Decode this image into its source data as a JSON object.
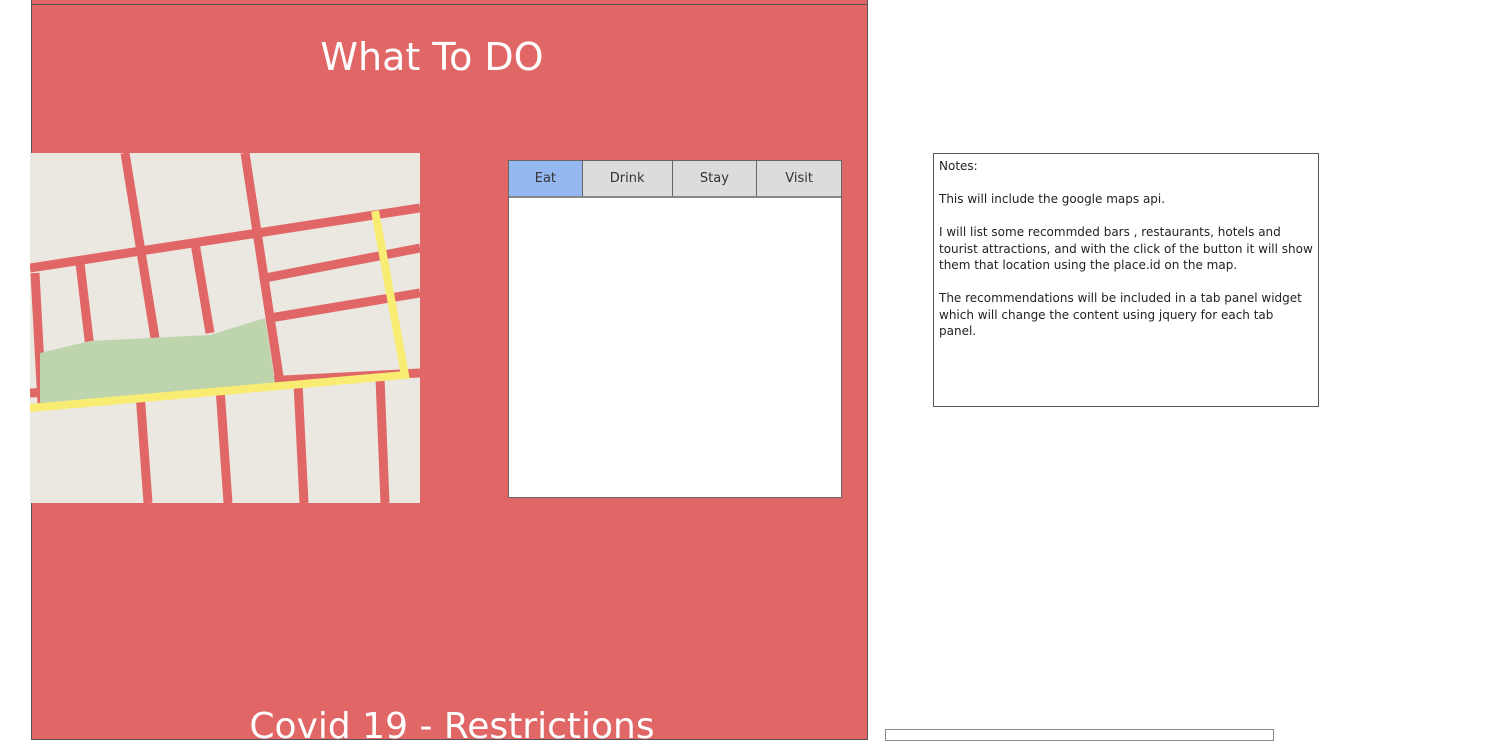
{
  "section_title": "What To DO",
  "next_section_title": "Covid 19 - Restrictions",
  "tabs": [
    {
      "label": "Eat",
      "active": true
    },
    {
      "label": "Drink",
      "active": false
    },
    {
      "label": "Stay",
      "active": false
    },
    {
      "label": "Visit",
      "active": false
    }
  ],
  "notes": {
    "heading": "Notes:",
    "paragraphs": [
      "This will include the google maps api.",
      "I will list some recommded bars , restaurants, hotels and tourist attractions, and with the click of the button it will show them that location using the place.id on the map.",
      "The recommendations will be included in a tab panel widget which will change the content using jquery for each tab panel."
    ]
  },
  "colors": {
    "panel": "#e06766",
    "tab_active": "#94b8ef",
    "tab_inactive": "#dcdcdc",
    "map_bg": "#ebe8e2",
    "park": "#bed4ad",
    "highway": "#f9ec72"
  }
}
